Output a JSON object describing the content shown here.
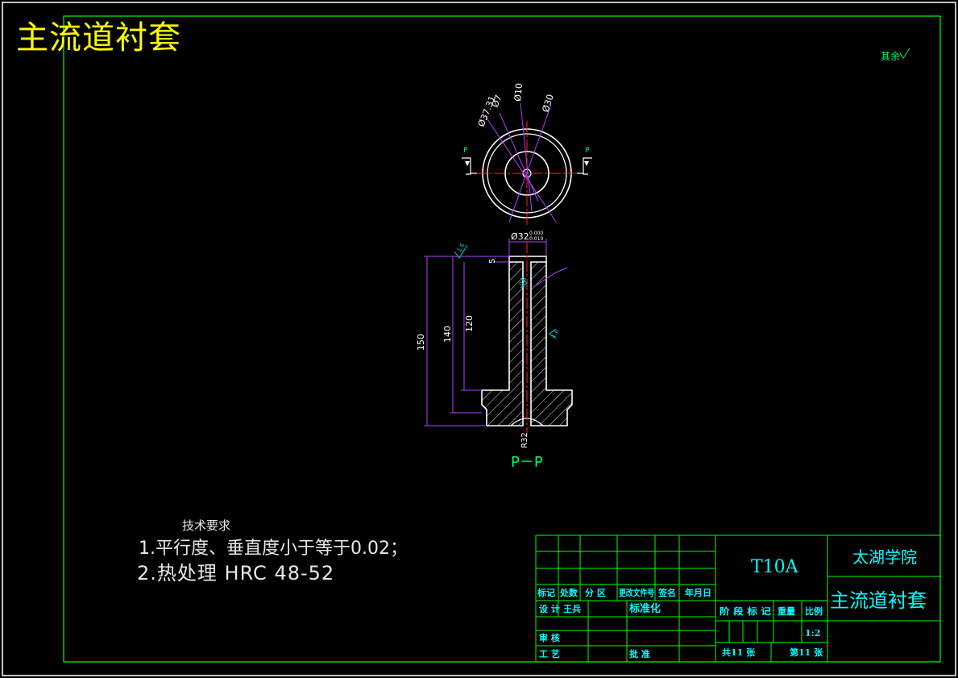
{
  "drawing": {
    "title_corner": "主流道衬套",
    "roughness_rest": "其余",
    "section_label": "P－P",
    "cut_marker": "P",
    "dimensions": {
      "d_37_31": "Ø37.31",
      "d_7": "Ø7",
      "d_10": "Ø10",
      "d_30": "Ø30",
      "d_32": "Ø32",
      "tol_upper": "0.000",
      "tol_lower": "-0.010",
      "len_150": "150",
      "len_140": "140",
      "len_120": "120",
      "len_5": "5",
      "radius": "R32"
    },
    "roughness": {
      "r_top": "1.6",
      "r_bore": "0.8",
      "r_side": "1.6"
    }
  },
  "tech_requirements": {
    "title": "技术要求",
    "line1": "1.平行度、垂直度小于等于0.02；",
    "line2": "2.热处理  HRC  48-52"
  },
  "title_block": {
    "headers": [
      "标记",
      "处数",
      "分 区",
      "更改文件号",
      "签名",
      "年月日"
    ],
    "design_label": "设 计",
    "designer": "王兵",
    "standard_label": "标准化",
    "review_label": "审 核",
    "process_label": "工 艺",
    "approve_label": "批 准",
    "material": "T10A",
    "stage_label": "阶 段 标 记",
    "weight_label": "重量",
    "scale_label": "比例",
    "scale": "1:2",
    "total_sheets": "共11 张",
    "sheet_no": "第11 张",
    "school": "太湖学院",
    "part_name": "主流道衬套"
  },
  "colors": {
    "border": "#00ff00",
    "outline": "#ffffff",
    "dimension": "#b040ff",
    "center": "#ff2020",
    "title": "#ffff00",
    "label": "#00ff66",
    "roughness": "#00ccdd"
  }
}
